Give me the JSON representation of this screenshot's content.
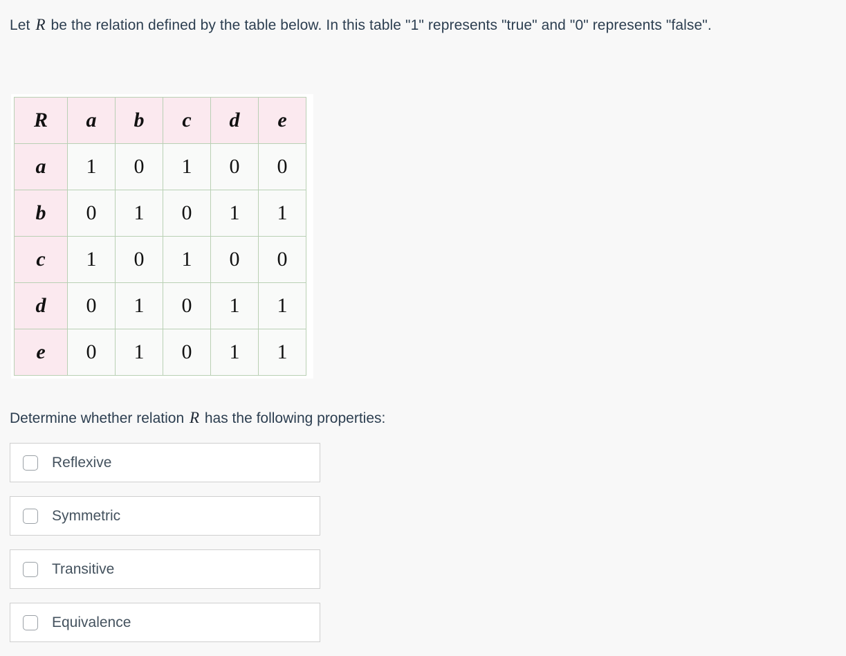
{
  "prompt": {
    "line1_before": "Let ",
    "relation_symbol": "R",
    "line1_after": " be the relation defined by the table below. In this table \"1\" represents \"true\" and \"0\" represents \"false\"."
  },
  "table": {
    "corner_label": "R",
    "columns": [
      "a",
      "b",
      "c",
      "d",
      "e"
    ],
    "rows": [
      {
        "label": "a",
        "values": [
          "1",
          "0",
          "1",
          "0",
          "0"
        ]
      },
      {
        "label": "b",
        "values": [
          "0",
          "1",
          "0",
          "1",
          "1"
        ]
      },
      {
        "label": "c",
        "values": [
          "1",
          "0",
          "1",
          "0",
          "0"
        ]
      },
      {
        "label": "d",
        "values": [
          "0",
          "1",
          "0",
          "1",
          "1"
        ]
      },
      {
        "label": "e",
        "values": [
          "0",
          "1",
          "0",
          "1",
          "1"
        ]
      }
    ]
  },
  "question": {
    "before": "Determine whether relation ",
    "relation_symbol": "R",
    "after": " has the following properties:"
  },
  "options": [
    {
      "label": "Reflexive",
      "checked": false
    },
    {
      "label": "Symmetric",
      "checked": false
    },
    {
      "label": "Transitive",
      "checked": false
    },
    {
      "label": "Equivalence",
      "checked": false
    }
  ],
  "colors": {
    "page_background": "#f8f8f8",
    "text": "#2c3e50",
    "table_border": "#b9d0b4",
    "table_header_fill": "#fbe9ef",
    "table_cell_fill": "#f9faf9",
    "option_border": "#cfcfcf",
    "checkbox_border": "#9aa0a6"
  }
}
